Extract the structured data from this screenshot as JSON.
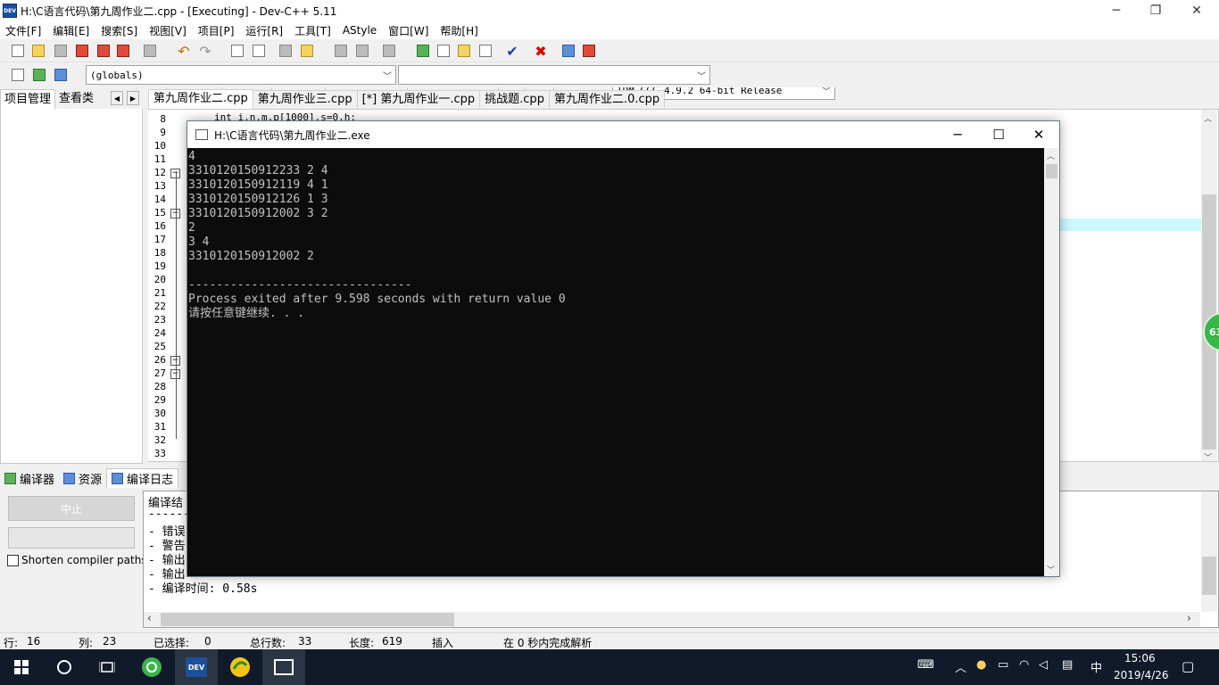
{
  "window": {
    "title": "H:\\C语言代码\\第九周作业二.cpp - [Executing] - Dev-C++ 5.11",
    "app_icon_text": "DEV"
  },
  "menu": [
    "文件[F]",
    "编辑[E]",
    "搜索[S]",
    "视图[V]",
    "项目[P]",
    "运行[R]",
    "工具[T]",
    "AStyle",
    "窗口[W]",
    "帮助[H]"
  ],
  "toolbar": {
    "compiler_select": "TDM-GCC 4.9.2 64-bit Release",
    "globals_select": "(globals)",
    "function_select": ""
  },
  "left_panel": {
    "tabs": [
      "项目管理",
      "查看类"
    ]
  },
  "editor": {
    "tabs": [
      "第九周作业二.cpp",
      "第九周作业三.cpp",
      "[*] 第九周作业一.cpp",
      "挑战题.cpp",
      "第九周作业二.0.cpp"
    ],
    "active_tab": 0,
    "line_numbers": [
      "8",
      "9",
      "10",
      "11",
      "12",
      "13",
      "14",
      "15",
      "16",
      "17",
      "18",
      "19",
      "20",
      "21",
      "22",
      "23",
      "24",
      "25",
      "26",
      "27",
      "28",
      "29",
      "30",
      "31",
      "32",
      "33"
    ],
    "code_line_8": "int i,n,m,p[1000],s=0,h;",
    "badge": "63"
  },
  "bottom": {
    "tabs": [
      "编译器",
      "资源",
      "编译日志"
    ],
    "stop_label": "中止",
    "shorten_label": "Shorten compiler paths",
    "log_lines": [
      "编译结",
      "-------",
      "- 错误",
      "- 警告",
      "- 输出",
      "- 输出",
      "- 编译时间: 0.58s"
    ]
  },
  "status": {
    "row_label": "行:",
    "row": "16",
    "col_label": "列:",
    "col": "23",
    "sel_label": "已选择:",
    "sel": "0",
    "total_label": "总行数:",
    "total": "33",
    "len_label": "长度:",
    "len": "619",
    "mode": "插入",
    "parse": "在 0 秒内完成解析"
  },
  "console": {
    "title": "H:\\C语言代码\\第九周作业二.exe",
    "lines": [
      "4",
      "3310120150912233 2 4",
      "3310120150912119 4 1",
      "3310120150912126 1 3",
      "3310120150912002 3 2",
      "2",
      "3 4",
      "3310120150912002 2",
      "",
      "--------------------------------",
      "Process exited after 9.598 seconds with return value 0",
      "请按任意键继续. . ."
    ]
  },
  "taskbar": {
    "ime": "中",
    "time": "15:06",
    "date": "2019/4/26"
  }
}
